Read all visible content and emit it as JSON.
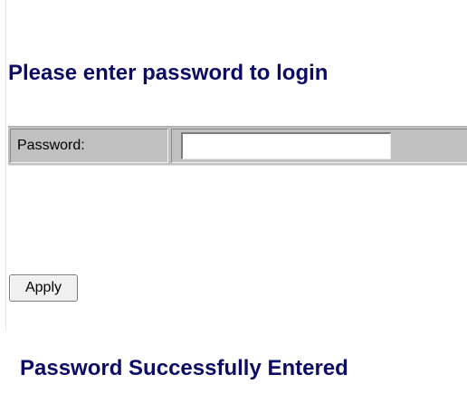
{
  "login": {
    "title": "Please enter password to login",
    "password_label": "Password:",
    "password_value": "",
    "apply_label": "Apply"
  },
  "status": {
    "message": "Password Successfully Entered"
  },
  "colors": {
    "heading": "#0c0c64",
    "row_background": "#c0c0c0"
  }
}
